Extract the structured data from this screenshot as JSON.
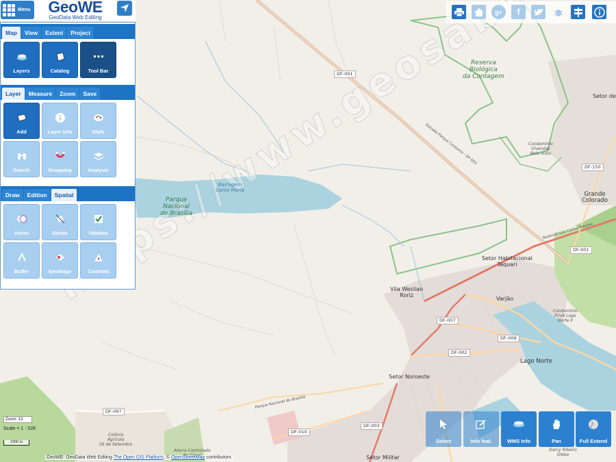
{
  "header": {
    "menu_label": "Menu",
    "logo_title": "GeoWE",
    "logo_subtitle": "GeoData Web Editing",
    "menu_icon": "grid-icon",
    "locate_icon": "navigation-arrow-icon"
  },
  "panel": {
    "map_tabs": [
      "Map",
      "View",
      "Extent",
      "Project"
    ],
    "map_buttons": [
      {
        "label": "Layers",
        "icon": "layers-icon"
      },
      {
        "label": "Catalog",
        "icon": "book-icon"
      },
      {
        "label": "Tool Bar",
        "icon": "dots-icon"
      }
    ],
    "layer_tabs": [
      "Layer",
      "Measure",
      "Zoom",
      "Save"
    ],
    "layer_buttons": [
      {
        "label": "Add",
        "icon": "add-layer-icon"
      },
      {
        "label": "Layer Info",
        "icon": "info-icon"
      },
      {
        "label": "Style",
        "icon": "palette-icon"
      },
      {
        "label": "Search",
        "icon": "binoculars-icon"
      },
      {
        "label": "Snapping",
        "icon": "magnet-icon"
      },
      {
        "label": "Analysis",
        "icon": "stack-icon"
      }
    ],
    "draw_tabs": [
      "Draw",
      "Edition",
      "Spatial"
    ],
    "spatial_buttons": [
      {
        "label": "Union",
        "icon": "union-icon"
      },
      {
        "label": "Divide",
        "icon": "divide-icon"
      },
      {
        "label": "Validate",
        "icon": "checkbox-icon"
      },
      {
        "label": "Buffer",
        "icon": "buffer-icon"
      },
      {
        "label": "Envelope",
        "icon": "envelope-icon"
      },
      {
        "label": "Centroid",
        "icon": "centroid-icon"
      }
    ]
  },
  "top_icons": [
    "printer-icon",
    "home-icon",
    "google-plus-icon",
    "facebook-icon",
    "twitter-icon",
    "bug-icon",
    "signpost-icon",
    "info-icon"
  ],
  "bottom_toolbar": [
    {
      "label": "Select",
      "icon": "cursor-icon"
    },
    {
      "label": "Info feat.",
      "icon": "edit-icon"
    },
    {
      "label": "WMS Info",
      "icon": "layers-info-icon"
    },
    {
      "label": "Pan",
      "icon": "hand-icon"
    },
    {
      "label": "Full Extend",
      "icon": "globe-icon"
    }
  ],
  "map_info": {
    "zoom": "Zoom: 13",
    "scale": "Scale = 1 : 52K",
    "scale_bar": "1000 m",
    "attribution_prefix": "GeoWE: GeoData Web Editing",
    "attribution_link1": "The Open GIS Platform",
    "attribution_sep": ", ©",
    "attribution_link2": "OpenStreetMap",
    "attribution_suffix": "contributors"
  },
  "map_labels": {
    "reserva": "Reserva\nBiológica\nda Contagem",
    "parque": "Parque\nNacional\nde Brasília",
    "barragem": "Barragem\nSanta Maria",
    "setor_de": "Setor de",
    "grande_colorado": "Grande Colorado",
    "condominio_vivendas": "Condomínio\nVivendas\nBela Vista",
    "setor_taquari": "Setor Habitacional\nTaquari",
    "vila_weslian": "Vila Weslian\nRoriz",
    "varjao": "Varjão",
    "lago_norte": "Lago Norte",
    "setor_noroeste": "Setor Noroeste",
    "colonia": "Colônia\nAgrícola\n26 de Setembro",
    "setor_militar": "Setor Militar",
    "condominio_lago": "Condomínio\nPrivê Lago\nNorte II",
    "darcy": "Darcy Ribeiro\nGleba",
    "aterro": "Aterro Controlado\ndo Jóquei"
  },
  "road_shields": [
    "DF-001",
    "DF-150",
    "DF-001",
    "DF-007",
    "DF-009",
    "DF-002",
    "DF-097",
    "DF-010",
    "DF-003"
  ],
  "road_names": {
    "rodovia": "Rodovia Luiz Carlos Prestes",
    "estrada": "Estrada Parque Contorno - DF-001",
    "parque_road": "Parque Nacional de Brasília"
  },
  "watermark": "https://www.geosaber.com.br"
}
